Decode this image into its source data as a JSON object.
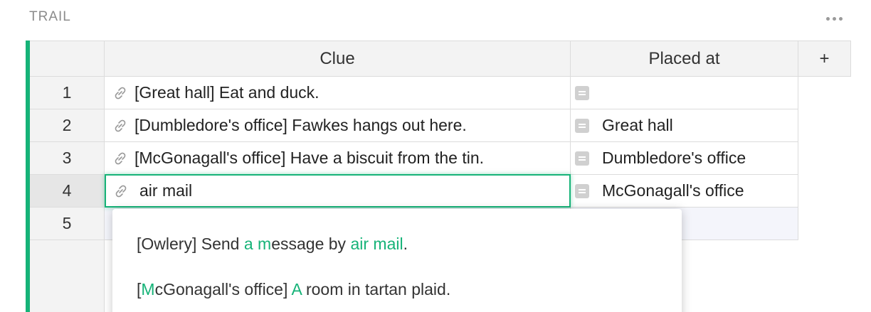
{
  "widget": {
    "title": "TRAIL",
    "menu_icon": "more-dots-icon"
  },
  "colors": {
    "accent": "#16b378",
    "header_bg": "#f3f3f3",
    "active_row_bg": "#e6e6e6",
    "new_row_bg": "#f4f5fb"
  },
  "table": {
    "columns": [
      "Clue",
      "Placed at"
    ],
    "add_column_label": "+",
    "rows": [
      {
        "num": "1",
        "clue": "[Great hall] Eat and duck.",
        "placed_at": ""
      },
      {
        "num": "2",
        "clue": "[Dumbledore's office] Fawkes hangs out here.",
        "placed_at": "Great hall"
      },
      {
        "num": "3",
        "clue": "[McGonagall's office] Have a biscuit from the tin.",
        "placed_at": "Dumbledore's office"
      },
      {
        "num": "4",
        "clue": "",
        "placed_at": "McGonagall's office"
      },
      {
        "num": "5",
        "clue": "",
        "placed_at": ""
      }
    ],
    "active_row": "4"
  },
  "editor": {
    "value": "air mail",
    "icon": "link-icon"
  },
  "dropdown": {
    "items": [
      {
        "segments": [
          {
            "text": "[Owlery] Send ",
            "hl": false
          },
          {
            "text": "a",
            "hl": true
          },
          {
            "text": " ",
            "hl": false
          },
          {
            "text": "m",
            "hl": true
          },
          {
            "text": "essage by ",
            "hl": false
          },
          {
            "text": "air mail",
            "hl": true
          },
          {
            "text": ".",
            "hl": false
          }
        ]
      },
      {
        "segments": [
          {
            "text": "[",
            "hl": false
          },
          {
            "text": "M",
            "hl": true
          },
          {
            "text": "cGonagall's office] ",
            "hl": false
          },
          {
            "text": "A",
            "hl": true
          },
          {
            "text": " room in tartan plaid.",
            "hl": false
          }
        ]
      }
    ]
  }
}
